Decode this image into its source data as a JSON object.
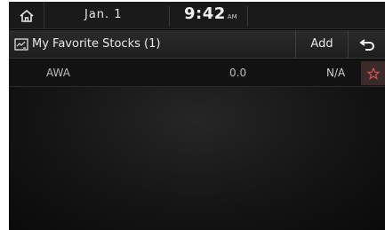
{
  "status_bar": {
    "date": "Jan. 1",
    "time": "9:42",
    "ampm": "AM"
  },
  "header": {
    "title": "My Favorite Stocks (1)",
    "add_label": "Add"
  },
  "stocks": [
    {
      "symbol": "AWA",
      "value": "0.0",
      "change": "N/A"
    }
  ],
  "icons": {
    "home": "home-icon",
    "favorites": "favorites-list-icon",
    "back": "back-arrow-icon",
    "star": "star-outline-icon"
  },
  "colors": {
    "star": "#d9534f"
  }
}
